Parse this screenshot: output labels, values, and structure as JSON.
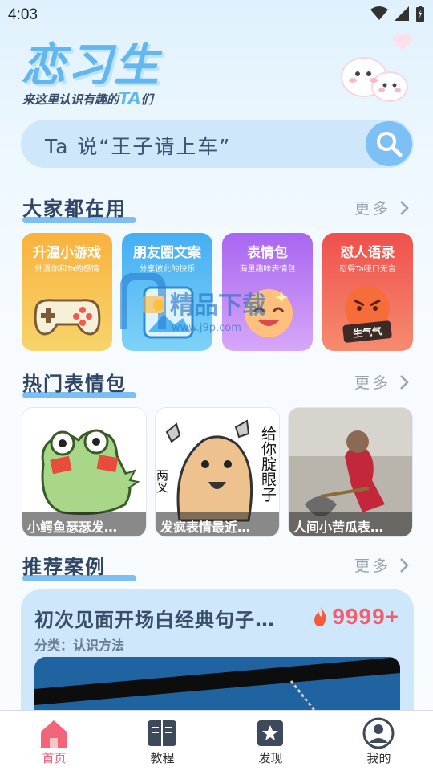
{
  "status_bar": {
    "time": "4:03"
  },
  "header": {
    "app_name": "恋习生",
    "slogan_prefix": "来这里认识有趣的",
    "slogan_ta": "TA",
    "slogan_suffix": "们"
  },
  "search": {
    "placeholder": "Ta 说“王子请上车”"
  },
  "sections": {
    "popular_tools": {
      "title": "大家都在用",
      "more": "更多"
    },
    "hot_stickers": {
      "title": "热门表情包",
      "more": "更多"
    },
    "recommended": {
      "title": "推荐案例",
      "more": "更多"
    }
  },
  "tools": [
    {
      "title": "升温小游戏",
      "subtitle": "升温你和Ta的感情",
      "color": "#f7a93a"
    },
    {
      "title": "朋友圈文案",
      "subtitle": "分享彼此的快乐",
      "color": "#4fb5f4"
    },
    {
      "title": "表情包",
      "subtitle": "海量趣味表情包",
      "color": "#b56ff0"
    },
    {
      "title": "怼人语录",
      "subtitle": "怼得Ta哑口无言",
      "color": "#f25a4f"
    }
  ],
  "stickers": [
    {
      "caption": "小鳄鱼瑟瑟发…"
    },
    {
      "caption": "发疯表情最近…",
      "text_right": "给你腚眼子",
      "text_left": "两叉"
    },
    {
      "caption": "人间小苦瓜表…"
    }
  ],
  "case": {
    "title": "初次见面开场白经典句子…",
    "count": "9999+",
    "category": "分类：认识方法"
  },
  "watermark": {
    "text": "精品下载",
    "url": "www.j9p.com"
  },
  "tabs": [
    {
      "label": "首页",
      "active": true
    },
    {
      "label": "教程",
      "active": false
    },
    {
      "label": "发现",
      "active": false
    },
    {
      "label": "我的",
      "active": false
    }
  ],
  "sticker_badge": "生气气"
}
